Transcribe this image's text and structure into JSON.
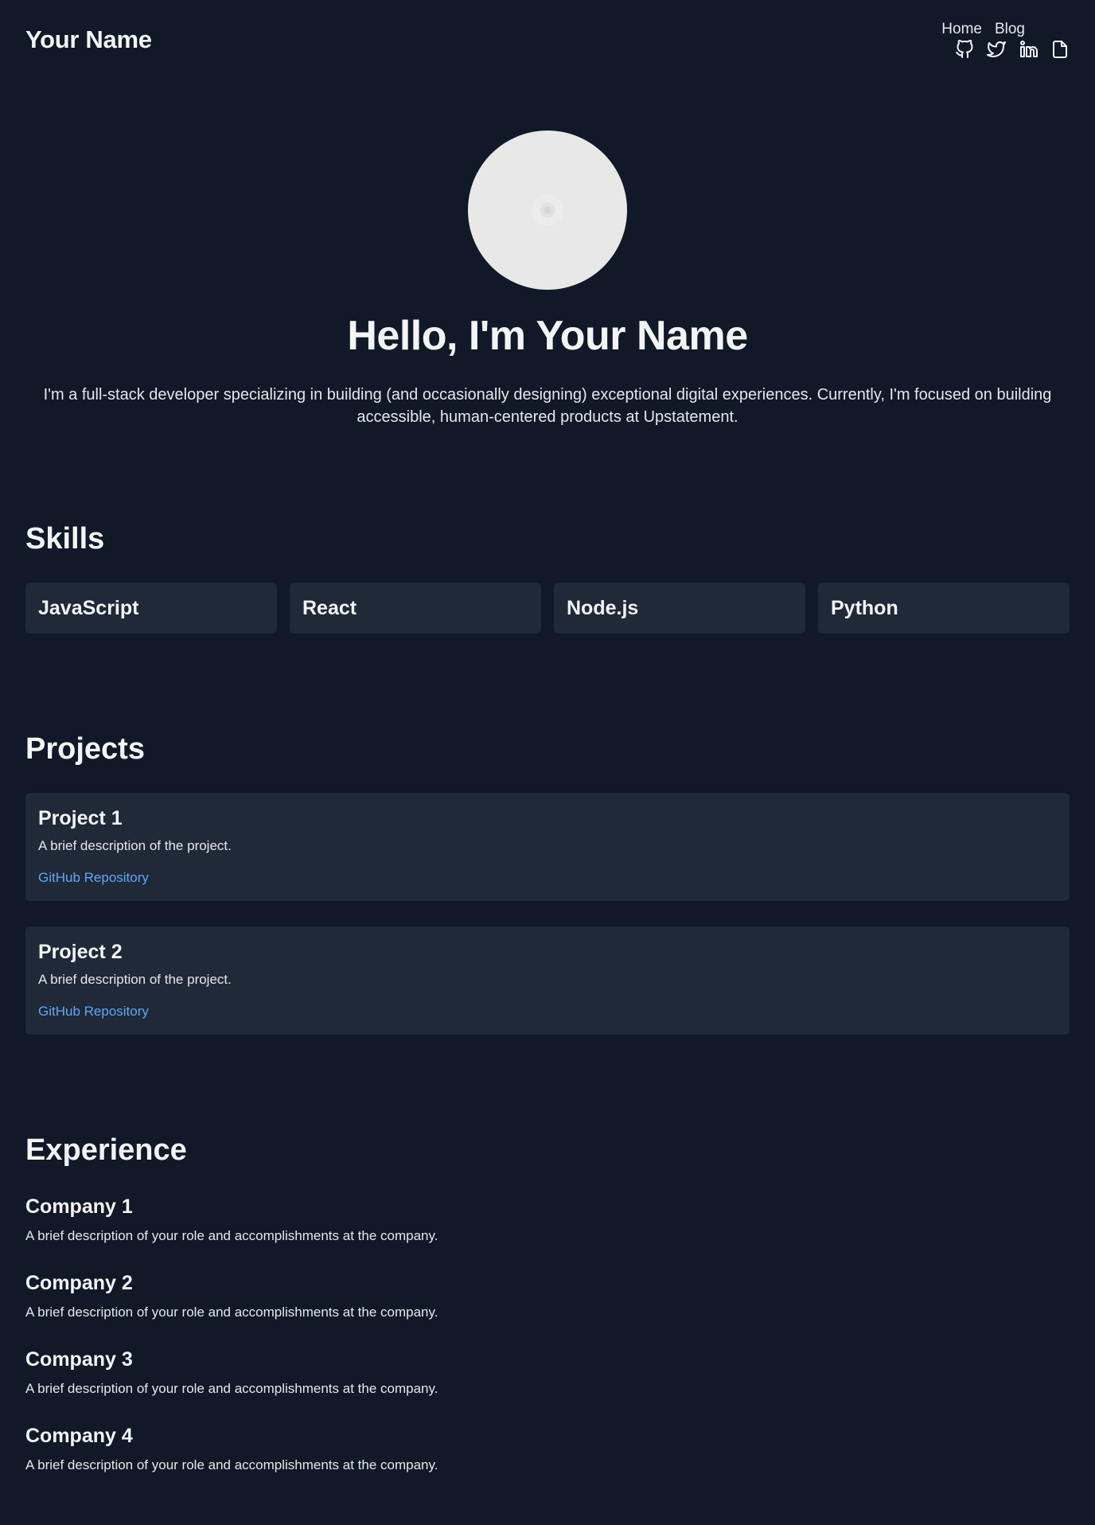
{
  "header": {
    "brand": "Your Name",
    "nav": [
      {
        "label": "Home"
      },
      {
        "label": "Blog"
      }
    ],
    "socials": [
      "github-icon",
      "twitter-icon",
      "linkedin-icon",
      "resume-file-icon"
    ]
  },
  "hero": {
    "title": "Hello, I'm Your Name",
    "bio": "I'm a full-stack developer specializing in building (and occasionally designing) exceptional digital experiences. Currently, I'm focused on building accessible, human-centered products at Upstatement."
  },
  "skills": {
    "title": "Skills",
    "items": [
      "JavaScript",
      "React",
      "Node.js",
      "Python"
    ]
  },
  "projects": {
    "title": "Projects",
    "items": [
      {
        "name": "Project 1",
        "description": "A brief description of the project.",
        "link": "GitHub Repository"
      },
      {
        "name": "Project 2",
        "description": "A brief description of the project.",
        "link": "GitHub Repository"
      }
    ]
  },
  "experience": {
    "title": "Experience",
    "items": [
      {
        "company": "Company 1",
        "description": "A brief description of your role and accomplishments at the company."
      },
      {
        "company": "Company 2",
        "description": "A brief description of your role and accomplishments at the company."
      },
      {
        "company": "Company 3",
        "description": "A brief description of your role and accomplishments at the company."
      },
      {
        "company": "Company 4",
        "description": "A brief description of your role and accomplishments at the company."
      }
    ]
  },
  "colors": {
    "background": "#111827",
    "card": "#1f2937",
    "text": "#f3f4f6",
    "link": "#60a5fa"
  }
}
